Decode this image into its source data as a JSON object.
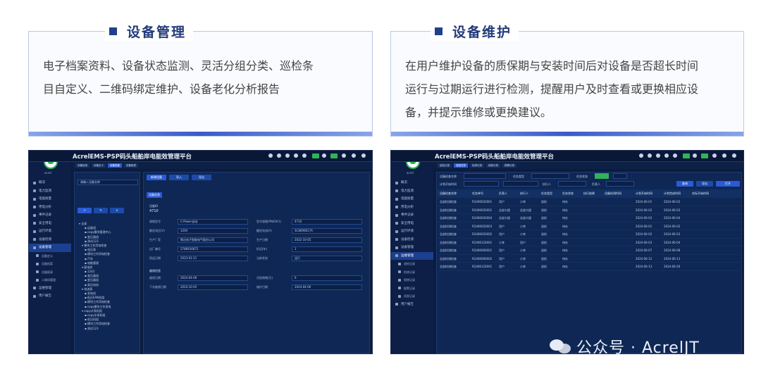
{
  "cards": [
    {
      "title": "设备管理",
      "lines": [
        "电子档案资料、设备状态监测、灵活分组分类、巡检条",
        "目自定义、二维码绑定维护、设备老化分析报告"
      ]
    },
    {
      "title": "设备维护",
      "lines": [
        "在用户维护设备的质保期与安装时间后对设备是否超长时间",
        "运行与过期运行进行检测，提醒用户及时查看或更换相应设",
        "备，并提示维修或更换建议。"
      ]
    }
  ],
  "app_title": "AcrelEMS-PSP码头船舶岸电能效管理平台",
  "colors": {
    "accent": "#2a5bd6",
    "brand_green": "#2db058",
    "header_blue": "#233b7a"
  },
  "left_screen": {
    "menu": [
      "概况",
      "电力监测",
      "电能质量",
      "用电分析",
      "事件记录",
      "安全用电",
      "运行环境",
      "设备检测",
      "设备管理",
      "设备定义",
      "设备档案",
      "设备报表",
      "二维码管理",
      "运维管理",
      "用户报告"
    ],
    "search_placeholder": "请输入设备名称",
    "detail_title": "设备ID",
    "detail_id": "4710",
    "fields": [
      [
        "规格型号",
        "C-Power自动",
        "型号规格(PN/EN:1)",
        "4710"
      ],
      [
        "额定电压(V)",
        "120V",
        "额定电流(A)",
        "SC8096617A"
      ],
      [
        "生产厂家",
        "颐达电子智能电气股份公司",
        "生产日期",
        "2022-10-05"
      ],
      [
        "出厂编号",
        "5786934872",
        "折旧(年)",
        "1"
      ],
      [
        "投运日期",
        "2023-01-11",
        "当前状态",
        "运行"
      ]
    ],
    "maint_fields": [
      [
        "维保日期",
        "2024-04-06",
        "试验周期(天)",
        "6"
      ],
      [
        "下次维保日期",
        "2024-10-05",
        "维护日期",
        "2024-04-06"
      ]
    ],
    "tree": [
      "全部",
      "运维组",
      "copy模块管理中心",
      "变压器组",
      "测试123",
      "模块工作用电检查",
      "电压表",
      "模块工作用电检查",
      "汽车",
      "电能管理",
      "配电房",
      "1243",
      "变压器组",
      "变压器组",
      "高压电机",
      "电流表",
      "发电机",
      "低压EAN机组",
      "模块工作用电检查",
      "copy模块工作用电",
      "copy水泵机组",
      "copy水泵机组",
      "低压机组",
      "模块工作用电检查",
      "测试123"
    ]
  },
  "right_screen": {
    "menu": [
      "概况",
      "电力监测",
      "电能质量",
      "用电分析",
      "事件记录",
      "安全用电",
      "运行环境",
      "设备检测",
      "设备管理",
      "运维管理",
      "巡检记录",
      "检修记录",
      "保修记录",
      "报警记录",
      "消息记录",
      "用户报告"
    ],
    "filter_labels": [
      "设备检查名称",
      "任务类型",
      "任务状态",
      "计划开始时间",
      "执行人",
      "负责人",
      "执行人"
    ],
    "buttons": [
      "查询",
      "导出",
      "打开"
    ],
    "columns": [
      "设备检查名称",
      "任务单号",
      "负责人",
      "执行人",
      "任务类型",
      "任务状态",
      "执行结果",
      "设备检测时间",
      "计划开始时间",
      "计划完成时间",
      "实际开始时间"
    ],
    "rows": [
      [
        "总部检测检查",
        "R2406020001",
        "用户",
        "小李",
        "巡检",
        "待办",
        "",
        "",
        "2024-06-01",
        "2024-06-02",
        ""
      ],
      [
        "总部检测检查",
        "R2406020001",
        "总部大楼",
        "总部大楼",
        "巡检",
        "待办",
        "",
        "",
        "2024-06-02",
        "2024-06-03",
        ""
      ],
      [
        "总部检测检查",
        "R2406020004",
        "总部大楼",
        "总部大楼",
        "巡检",
        "待办",
        "",
        "",
        "2024-06-03",
        "2024-06-04",
        ""
      ],
      [
        "总部检测检查",
        "R2406020003",
        "用户",
        "小李",
        "巡检",
        "待办",
        "",
        "",
        "2024-06-01",
        "2024-06-02",
        ""
      ],
      [
        "总部检测检查",
        "R2406020002",
        "用户",
        "小李",
        "巡检",
        "待办",
        "",
        "",
        "2024-06-02",
        "2024-06-03",
        ""
      ],
      [
        "总部检测检查",
        "R2406120001",
        "小李",
        "用户",
        "巡检",
        "待办",
        "",
        "",
        "2024-06-03",
        "2024-06-04",
        ""
      ],
      [
        "总部检测检查",
        "R2406060001",
        "用户",
        "小李",
        "巡检",
        "待办",
        "",
        "",
        "2024-06-07",
        "2024-06-08",
        ""
      ],
      [
        "总部检测检查",
        "R2406060002",
        "用户",
        "小李",
        "巡检",
        "待办",
        "",
        "",
        "2024-06-12",
        "2024-06-13",
        ""
      ],
      [
        "总部检测检查",
        "R2406120001",
        "用户",
        "小李",
        "巡检",
        "待办",
        "",
        "",
        "2024-06-13",
        "2024-06-26",
        ""
      ]
    ]
  },
  "watermark": "公众号 · AcrelJT"
}
